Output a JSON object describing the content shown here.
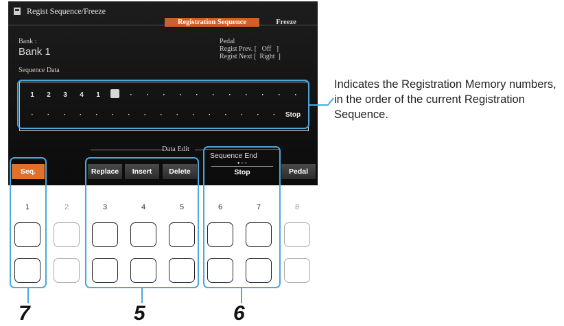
{
  "screen": {
    "title": "Regist Sequence/Freeze",
    "tabs": [
      {
        "label": "Registration Sequence",
        "active": true
      },
      {
        "label": "Freeze",
        "active": false
      }
    ],
    "bank_label": "Bank :",
    "bank_value": "Bank 1",
    "pedal_label": "Pedal",
    "regist_prev": "Regist Prev. [   Off   ]",
    "regist_next": "Regist Next [  Right  ]",
    "sequence_label": "Sequence Data",
    "sequence_row1": [
      "1",
      "2",
      "3",
      "4",
      "1",
      "■",
      "·",
      "·",
      "·",
      "·",
      "·",
      "·",
      "·",
      "·",
      "·",
      "·",
      "·"
    ],
    "sequence_row2": [
      "·",
      "·",
      "·",
      "·",
      "·",
      "·",
      "·",
      "·",
      "·",
      "·",
      "·",
      "·",
      "·",
      "·",
      "·",
      "·",
      "Stop"
    ],
    "data_edit_label": "Data Edit",
    "buttons": {
      "seq": "Seq.",
      "replace": "Replace",
      "insert": "Insert",
      "delete": "Delete",
      "sequence_end_label": "Sequence End",
      "sequence_end_dots": "● ○ ○",
      "sequence_end_value": "Stop",
      "pedal": "Pedal"
    }
  },
  "panel_numbers": [
    "1",
    "2",
    "3",
    "4",
    "5",
    "6",
    "7",
    "8"
  ],
  "callouts": {
    "annotation": "Indicates the Registration Memory numbers, in the order of the current Registration Sequence.",
    "labels": [
      "7",
      "5",
      "6"
    ]
  },
  "colors": {
    "accent_orange": "#e0702c",
    "callout_blue": "#4aa8dc",
    "screen_bg": "#141414"
  }
}
